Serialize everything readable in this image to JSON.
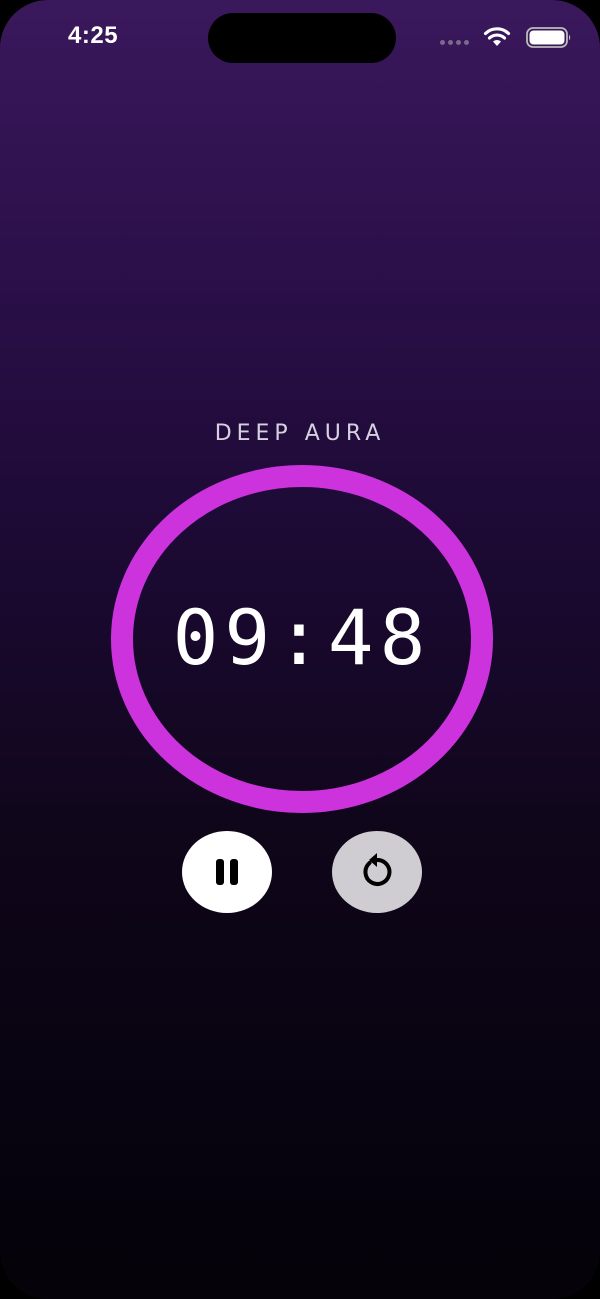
{
  "status_bar": {
    "time": "4:25",
    "wifi_icon": "wifi-icon",
    "battery_icon": "battery-icon"
  },
  "timer": {
    "title": "DEEP AURA",
    "time_display": "09:48",
    "ring_color": "#cc33dd",
    "progress": 1.0
  },
  "controls": {
    "pause_icon": "pause-icon",
    "reset_icon": "reset-icon",
    "pause_bg": "#ffffff",
    "reset_bg": "#cfcdd2"
  }
}
